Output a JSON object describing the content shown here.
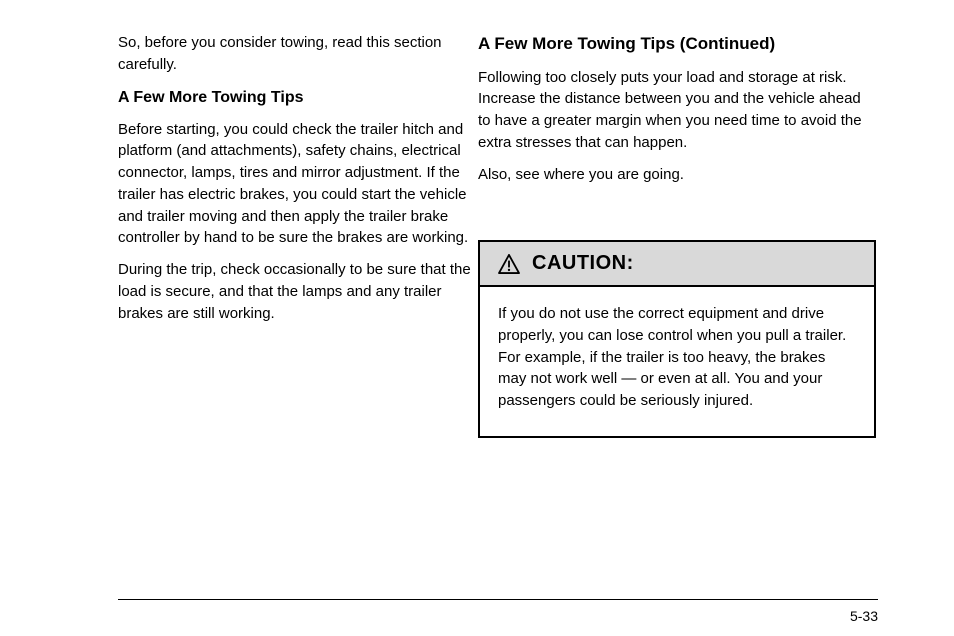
{
  "left": {
    "p1": "So, before you consider towing, read this section carefully.",
    "topic_heading": "A Few More Towing Tips",
    "p2": "Before starting, you could check the trailer hitch and platform (and attachments), safety chains, electrical connector, lamps, tires and mirror adjustment. If the trailer has electric brakes, you could start the vehicle and trailer moving and then apply the trailer brake controller by hand to be sure the brakes are working.",
    "p3": "During the trip, check occasionally to be sure that the load is secure, and that the lamps and any trailer brakes are still working."
  },
  "right": {
    "continue_heading": "A Few More Towing Tips (Continued)",
    "p1": "Following too closely puts your load and storage at risk. Increase the distance between you and the vehicle ahead to have a greater margin when you need time to avoid the extra stresses that can happen.",
    "p2": "Also, see where you are going."
  },
  "caution": {
    "label": "CAUTION:",
    "body_plain": "If you do not use the correct equipment and drive properly, you can lose control when you pull a trailer. For example, if the trailer is too heavy, the brakes may not work well — or even at all. You and your passengers could be seriously injured.",
    "body_emph": "If you do not use the correct equipment and drive properly,"
  },
  "page_number": "5-33"
}
